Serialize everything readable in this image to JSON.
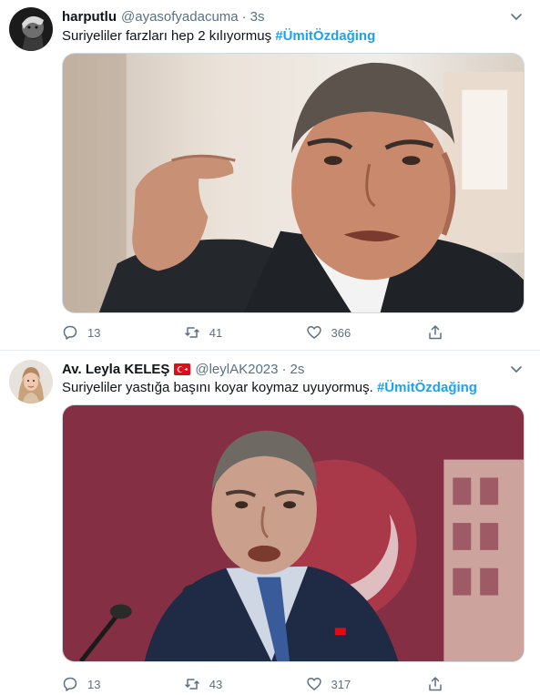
{
  "tweets": [
    {
      "display_name": "harputlu",
      "handle": "@ayasofyadacuma",
      "separator": "·",
      "time": "3s",
      "text_plain": "Suriyeliler farzları hep 2 kılıyormuş ",
      "hashtag": "#ÜmitÖzdağing",
      "avatar_icon": "avatar-bw-portrait",
      "media_description_icon": "photo-man-gesturing",
      "actions": {
        "replies": "13",
        "retweets": "41",
        "likes": "366"
      }
    },
    {
      "display_name": "Av. Leyla KELEŞ",
      "handle": "@leylAK2023",
      "separator": "·",
      "time": "2s",
      "text_plain": "Suriyeliler yastığa başını koyar koymaz uyuyormuş. ",
      "hashtag": "#ÜmitÖzdağing",
      "avatar_icon": "avatar-woman-headscarf",
      "flag_icon": "turkey-flag-icon",
      "media_description_icon": "photo-man-speaking-parliament",
      "actions": {
        "replies": "13",
        "retweets": "43",
        "likes": "317"
      }
    }
  ],
  "colors": {
    "hashtag": "#1da1f2",
    "secondary_text": "#5b7083",
    "primary_text": "#0f1419",
    "divider": "#e6ecf0"
  }
}
